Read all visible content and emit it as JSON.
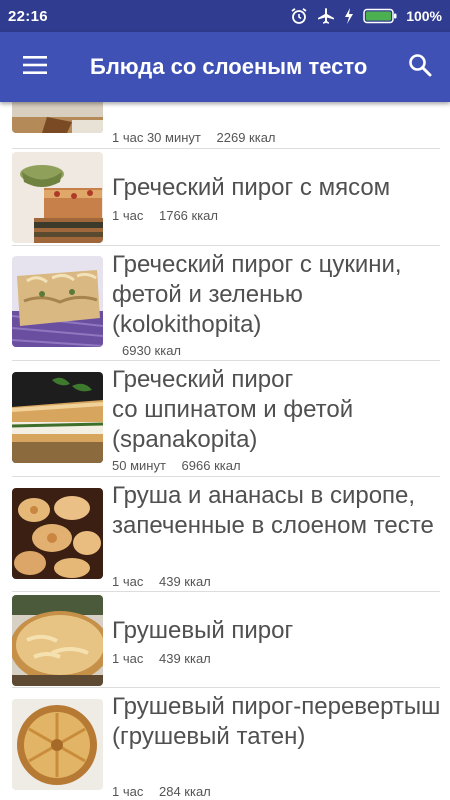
{
  "status_bar": {
    "time": "22:16",
    "icons": [
      "alarm-icon",
      "airplane-icon",
      "charging-icon",
      "battery-icon"
    ],
    "battery_percent": "100%"
  },
  "app_bar": {
    "title": "Блюда со слоеным тесто",
    "menu_icon": "hamburger-menu-icon",
    "search_icon": "search-icon"
  },
  "colors": {
    "status_bar": "#2f3c8f",
    "app_bar": "#3f51b5",
    "title_text": "#505050",
    "meta_text": "#555555",
    "battery_fill": "#4caf50"
  },
  "items": [
    {
      "title": "",
      "time": "1 час 30 минут",
      "kcal": "2269 ккал"
    },
    {
      "title": "Греческий пирог с мясом",
      "time": "1 час",
      "kcal": "1766 ккал"
    },
    {
      "title": "Греческий пирог с цукини, фетой и зеленью (kolokithopita)",
      "time": "",
      "kcal": "6930 ккал"
    },
    {
      "title": "Греческий пирог\nсо шпинатом и фетой (spanakopita)",
      "time": "50 минут",
      "kcal": "6966 ккал"
    },
    {
      "title": "Груша и ананасы в сиропе, запеченные в слоеном тесте",
      "time": "1 час",
      "kcal": "439 ккал"
    },
    {
      "title": "Грушевый пирог",
      "time": "1 час",
      "kcal": "439 ккал"
    },
    {
      "title": "Грушевый пирог-перевертыш (грушевый татен)",
      "time": "1 час",
      "kcal": "284 ккал"
    }
  ]
}
